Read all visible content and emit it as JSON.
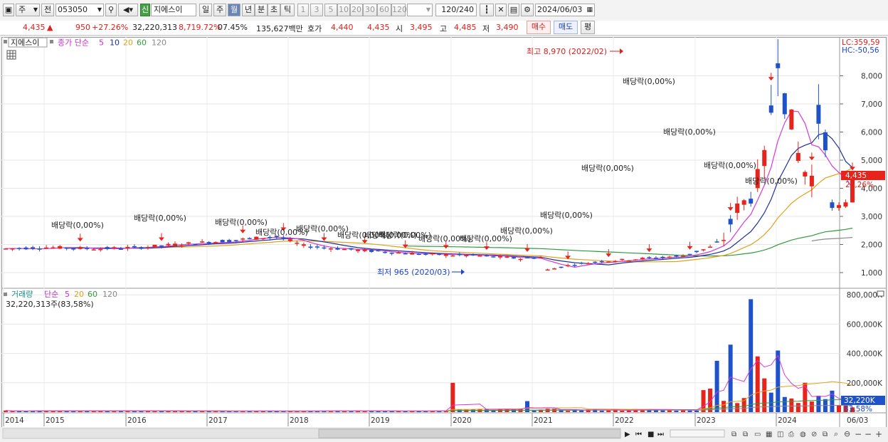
{
  "toolbar": {
    "period_label": "주",
    "prev_label": "전",
    "code": "053050",
    "badge": "신",
    "stock_name": "지에스이",
    "periods": [
      "일",
      "주",
      "월",
      "년",
      "분",
      "초",
      "틱"
    ],
    "active_period": "월",
    "intervals": [
      "1",
      "3",
      "5",
      "10",
      "20",
      "30",
      "60",
      "120"
    ],
    "count": "120",
    "count_max": "/240",
    "date": "2024/06/03"
  },
  "quote": {
    "price": "4,435",
    "arrow": "▲",
    "change": "950",
    "change_pct": "+27.26%",
    "volume": "32,220,313",
    "volume_pct": "8,719.72%",
    "turnover": "07.45%",
    "amount": "135,627백만",
    "hoga_label": "호가",
    "ask": "4,440",
    "bid": "4,435",
    "open_label": "시",
    "open": "3,495",
    "high_label": "고",
    "high": "4,485",
    "low_label": "저",
    "low": "3,490",
    "buy_label": "매수",
    "sell_label": "매도",
    "even_label": "평"
  },
  "legend_price": {
    "name": "지에스이",
    "ma_label": "종가 단순",
    "ma": [
      "5",
      "10",
      "20",
      "60",
      "120"
    ]
  },
  "legend_volume": {
    "name": "거래량",
    "ma_label": "단순",
    "ma": [
      "5",
      "20",
      "60",
      "120"
    ],
    "value": "32,220,313주(83,58%)"
  },
  "right_top": {
    "lc": "LC:359,59",
    "hc": "HC:-50,56"
  },
  "price_axis": [
    "8,000",
    "7,000",
    "6,000",
    "5,000",
    "4,000",
    "3,000",
    "2,000",
    "1,000"
  ],
  "price_tag": {
    "price": "4,435",
    "pct": "27,26%"
  },
  "volume_axis": [
    "800,000K",
    "600,000K",
    "400,000K",
    "200,000K"
  ],
  "volume_tag": {
    "value": "32,220K",
    "pct": "83,58%"
  },
  "x_axis": [
    "2014",
    "2015",
    "2016",
    "2017",
    "2018",
    "2019",
    "2020",
    "2021",
    "2022",
    "2023",
    "2024",
    "06/03"
  ],
  "annotations": {
    "high": "최고 8,970 (2022/02)",
    "low": "최저 965 (2020/03)",
    "dividend": "배당락(0,00%)"
  },
  "colors": {
    "up": "#e8231c",
    "down": "#1f52c9",
    "ma5": "#d53ad5",
    "ma10": "#1d2f9a",
    "ma20": "#e2a21b",
    "ma60": "#2f9b3c",
    "ma120": "#8a8a8a"
  }
}
